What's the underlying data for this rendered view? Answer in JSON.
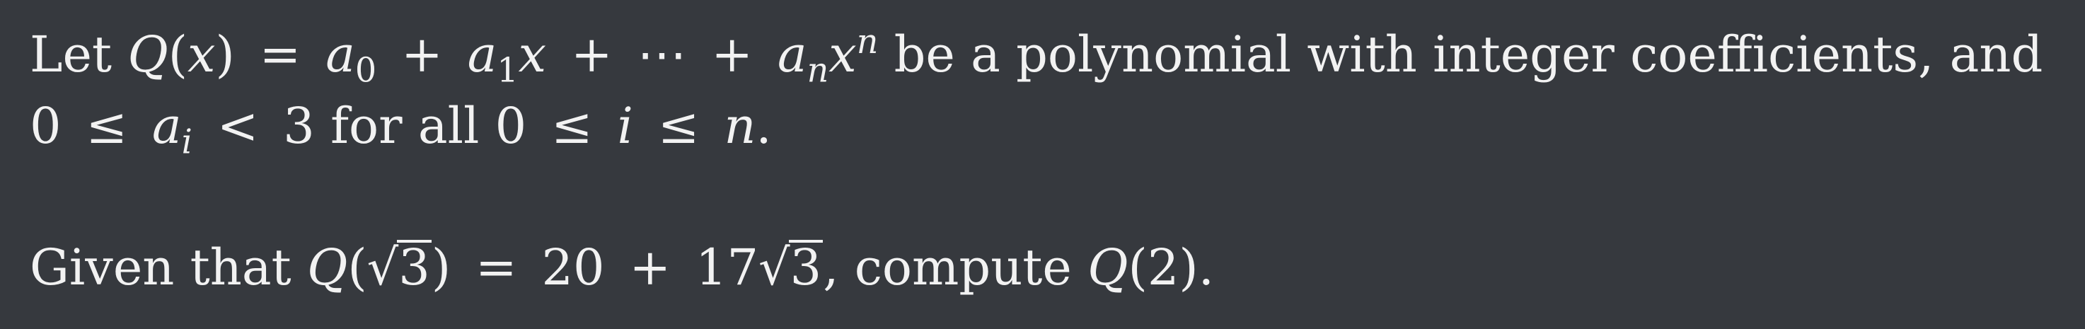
{
  "problem": {
    "line1": {
      "let": "Let",
      "Q": "Q",
      "open_paren": "(",
      "x": "x",
      "close_paren": ")",
      "eq": "=",
      "a": "a",
      "sub0": "0",
      "plus": "+",
      "sub1": "1",
      "dots": "⋯",
      "subn": "n",
      "supn": "n",
      "tail": "be a polynomial with integer coefficients, and"
    },
    "line2": {
      "zero": "0",
      "le": "≤",
      "a": "a",
      "subi": "i",
      "lt": "<",
      "three": "3",
      "for_all": "for all",
      "zero2": "0",
      "i": "i",
      "n": "n",
      "period": "."
    },
    "line3": {
      "given_that": "Given that",
      "Q": "Q",
      "open_paren": "(",
      "sqrt_sign": "√",
      "radicand": "3",
      "close_paren": ")",
      "eq": "=",
      "twenty": "20",
      "plus": "+",
      "seventeen": "17",
      "radicand2": "3",
      "comma_compute": ", compute",
      "Q2": "Q",
      "arg": "(2)",
      "period": "."
    }
  }
}
